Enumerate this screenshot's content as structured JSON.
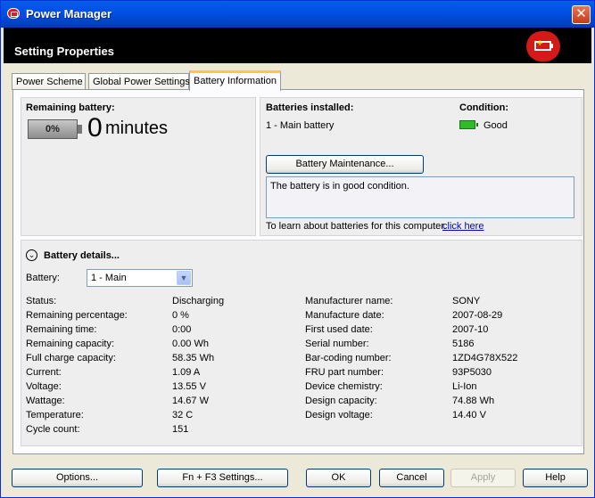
{
  "window": {
    "title": "Power Manager"
  },
  "header": {
    "heading": "Setting Properties"
  },
  "tabs": [
    {
      "label": "Power Scheme"
    },
    {
      "label": "Global Power Settings"
    },
    {
      "label": "Battery Information"
    }
  ],
  "remaining": {
    "label": "Remaining battery:",
    "percent": "0%",
    "minutes_value": "0",
    "minutes_unit": "minutes"
  },
  "installed": {
    "label": "Batteries installed:",
    "value": "1 - Main battery",
    "condition_label": "Condition:",
    "condition_value": "Good",
    "maintenance_button": "Battery Maintenance...",
    "message": "The battery is in good condition.",
    "learn_text": "To learn about batteries for this computer.",
    "learn_link": "click here"
  },
  "details": {
    "heading": "Battery details...",
    "battery_label": "Battery:",
    "battery_selected": "1 - Main",
    "left": [
      {
        "label": "Status:",
        "value": "Discharging"
      },
      {
        "label": "Remaining percentage:",
        "value": "0 %"
      },
      {
        "label": "Remaining time:",
        "value": "0:00"
      },
      {
        "label": "Remaining capacity:",
        "value": "0.00 Wh"
      },
      {
        "label": "Full charge capacity:",
        "value": "58.35 Wh"
      },
      {
        "label": "Current:",
        "value": "1.09 A"
      },
      {
        "label": "Voltage:",
        "value": "13.55 V"
      },
      {
        "label": "Wattage:",
        "value": "14.67 W"
      },
      {
        "label": "Temperature:",
        "value": "32 C"
      },
      {
        "label": "Cycle count:",
        "value": "151"
      }
    ],
    "right": [
      {
        "label": "Manufacturer name:",
        "value": "SONY"
      },
      {
        "label": "Manufacture date:",
        "value": "2007-08-29"
      },
      {
        "label": "First used date:",
        "value": "2007-10"
      },
      {
        "label": "Serial number:",
        "value": "5186"
      },
      {
        "label": "Bar-coding number:",
        "value": "1ZD4G78X522"
      },
      {
        "label": "FRU part number:",
        "value": "93P5030"
      },
      {
        "label": "Device chemistry:",
        "value": "Li-Ion"
      },
      {
        "label": "Design capacity:",
        "value": "74.88 Wh"
      },
      {
        "label": "Design voltage:",
        "value": "14.40 V"
      }
    ]
  },
  "buttons": {
    "options": "Options...",
    "fn_f3": "Fn + F3 Settings...",
    "ok": "OK",
    "cancel": "Cancel",
    "apply": "Apply",
    "help": "Help"
  },
  "colors": {
    "titlebar": "#0151e4",
    "header_band": "#000000",
    "logo_red": "#d41919",
    "condition_good": "#2fbc2b",
    "link": "#0000cc"
  },
  "icons": {
    "app": "battery-app-icon",
    "close": "close-icon",
    "logo": "battery-plus-icon",
    "condition": "battery-good-icon",
    "details_toggle": "chevron-circle-icon",
    "dropdown": "chevron-down-icon"
  }
}
